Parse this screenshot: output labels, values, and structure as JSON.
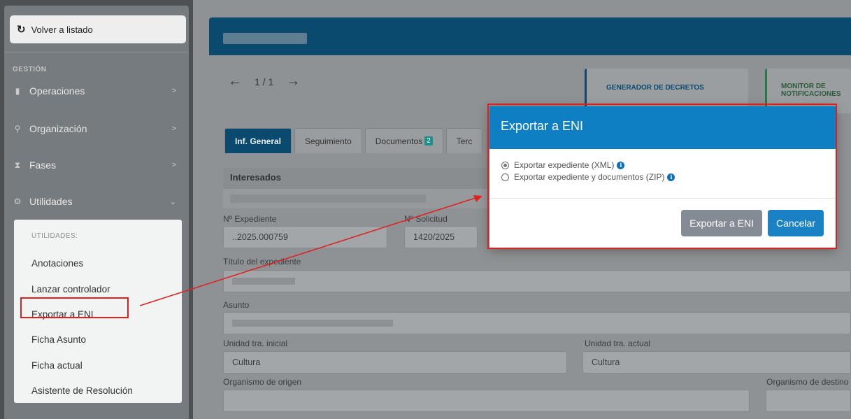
{
  "sidebar": {
    "back_label": "Volver a listado",
    "section_label": "GESTIÓN",
    "items": [
      {
        "label": "Operaciones"
      },
      {
        "label": "Organización"
      },
      {
        "label": "Fases"
      },
      {
        "label": "Utilidades"
      }
    ],
    "submenu": {
      "title": "UTILIDADES:",
      "items": [
        {
          "label": "Anotaciones"
        },
        {
          "label": "Lanzar controlador"
        },
        {
          "label": "Exportar a ENI"
        },
        {
          "label": "Ficha Asunto"
        },
        {
          "label": "Ficha actual"
        },
        {
          "label": "Asistente de Resolución"
        }
      ]
    }
  },
  "pager": {
    "text": "1 / 1"
  },
  "cards": {
    "generator": "GENERADOR DE DECRETOS",
    "monitor": "MONITOR DE NOTIFICACIONES"
  },
  "tabs": [
    {
      "label": "Inf. General",
      "active": true
    },
    {
      "label": "Seguimiento"
    },
    {
      "label": "Documentos",
      "badge": "2"
    },
    {
      "label": "Terc"
    }
  ],
  "form": {
    "interesados_label": "Interesados",
    "expediente_label": "Nº Expediente",
    "expediente_value": "..2025.000759",
    "solicitud_label": "Nº Solicitud",
    "solicitud_value": "1420/2025",
    "titulo_label": "Título del expediente",
    "asunto_label": "Asunto",
    "unidad_inicial_label": "Unidad tra. inicial",
    "unidad_inicial_value": "Cultura",
    "unidad_actual_label": "Unidad tra. actual",
    "unidad_actual_value": "Cultura",
    "organismo_origen_label": "Organismo de origen",
    "organismo_destino_label": "Organismo de destino",
    "side_fragment": "idad"
  },
  "modal": {
    "title": "Exportar a ENI",
    "options": [
      {
        "label": "Exportar expediente (XML)",
        "selected": true
      },
      {
        "label": "Exportar expediente y documentos (ZIP)",
        "selected": false
      }
    ],
    "export_button": "Exportar a ENI",
    "cancel_button": "Cancelar"
  },
  "colors": {
    "modal_header": "#0d7fc2",
    "highlight": "#e02020",
    "primary_button": "#1a82c4"
  }
}
